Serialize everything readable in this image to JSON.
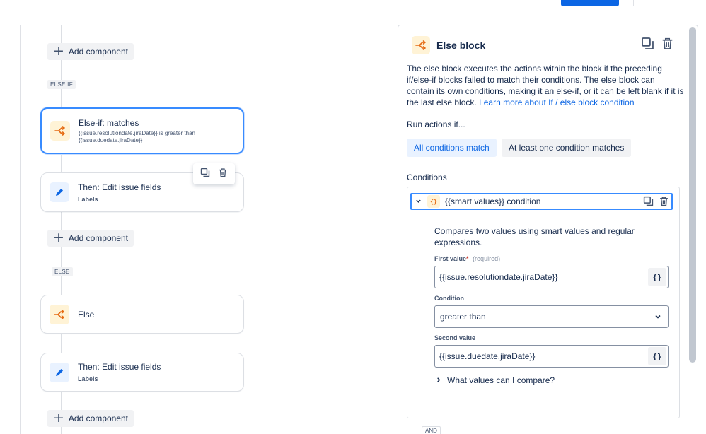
{
  "flow": {
    "add_component_label": "Add component",
    "tags": {
      "else_if": "ELSE IF",
      "else": "ELSE"
    },
    "cards": [
      {
        "title": "Else-if: matches",
        "detail": "{{issue.resolutiondate.jiraDate}} is greater than {{issue.duedate.jiraDate}}"
      },
      {
        "title": "Then: Edit issue fields",
        "subtitle": "Labels"
      },
      {
        "title": "Else"
      },
      {
        "title": "Then: Edit issue fields",
        "subtitle": "Labels"
      }
    ]
  },
  "panel": {
    "title": "Else block",
    "description": "The else block executes the actions within the block if the preceding if/else-if blocks failed to match their conditions. The else block can contain its own conditions, making it an else-if, or it can be left blank if it is the last else block.",
    "learn_more_link": "Learn more about If / else block condition",
    "run_actions_label": "Run actions if...",
    "match_options": [
      "All conditions match",
      "At least one condition matches"
    ],
    "conditions_label": "Conditions",
    "condition": {
      "badge": "{}",
      "title": "{{smart values}} condition",
      "description": "Compares two values using smart values and regular expressions.",
      "first_value_label": "First value",
      "required_marker": "*",
      "required_hint": "(required)",
      "first_value": "{{issue.resolutiondate.jiraDate}}",
      "condition_label": "Condition",
      "condition_value": "greater than",
      "second_value_label": "Second value",
      "second_value": "{{issue.duedate.jiraDate}}",
      "smart_value_button": "{}",
      "help_toggle": "What values can I compare?"
    },
    "and_tag": "AND"
  },
  "colors": {
    "accent": "#0c66e4",
    "selection_border": "#388bff",
    "branch_icon": "#e56910"
  },
  "icons": [
    "branch-icon",
    "pencil-icon",
    "copy-icon",
    "trash-icon",
    "plus-icon",
    "chevron-down-icon",
    "chevron-right-icon",
    "smart-value-icon"
  ]
}
